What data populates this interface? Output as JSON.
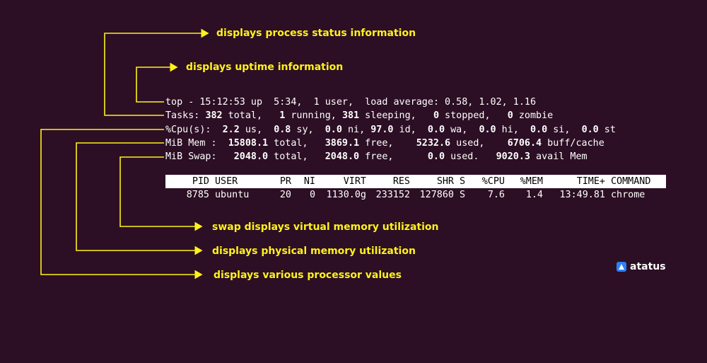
{
  "annotations": {
    "process_status": "displays process status information",
    "uptime": "displays uptime information",
    "swap": "swap displays virtual memory utilization",
    "physical_memory": "displays physical memory utilization",
    "processor": "displays various processor values"
  },
  "summary": {
    "top_line": {
      "prefix": "top - 15:12:53 up  5:34,  1 user,  load average: 0.58, 1.02, 1.16"
    },
    "tasks_line": {
      "label": "Tasks: ",
      "total": "382",
      "total_label": " total,   ",
      "running": "1",
      "running_label": " running, ",
      "sleeping": "381",
      "sleeping_label": " sleeping,   ",
      "stopped": "0",
      "stopped_label": " stopped,   ",
      "zombie": "0",
      "zombie_label": " zombie"
    },
    "cpu_line": {
      "label": "%Cpu(s):  ",
      "us": "2.2",
      "us_label": " us,  ",
      "sy": "0.8",
      "sy_label": " sy,  ",
      "ni": "0.0",
      "ni_label": " ni, ",
      "id": "97.0",
      "id_label": " id,  ",
      "wa": "0.0",
      "wa_label": " wa,  ",
      "hi": "0.0",
      "hi_label": " hi,  ",
      "si": "0.0",
      "si_label": " si,  ",
      "st": "0.0",
      "st_label": " st"
    },
    "mem_line": {
      "label": "MiB Mem :  ",
      "total": "15808.1",
      "total_label": " total,   ",
      "free": "3869.1",
      "free_label": " free,    ",
      "used": "5232.6",
      "used_label": " used,    ",
      "buff": "6706.4",
      "buff_label": " buff/cache"
    },
    "swap_line": {
      "label": "MiB Swap:   ",
      "total": "2048.0",
      "total_label": " total,   ",
      "free": "2048.0",
      "free_label": " free,      ",
      "used": "0.0",
      "used_label": " used.   ",
      "avail": "9020.3",
      "avail_label": " avail Mem"
    }
  },
  "process_table": {
    "columns": [
      "PID",
      "USER",
      "PR",
      "NI",
      "VIRT",
      "RES",
      "SHR",
      "S",
      "%CPU",
      "%MEM",
      "TIME+",
      "COMMAND"
    ],
    "rows": [
      [
        "8785",
        "ubuntu",
        "20",
        "0",
        "1130.0g",
        "233152",
        "127860",
        "S",
        "7.6",
        "1.4",
        "13:49.81",
        "chrome"
      ]
    ]
  },
  "logo": {
    "text": "atatus",
    "icon": "atatus-logo-icon",
    "color": "#2b7fff"
  },
  "colors": {
    "background": "#2c0f24",
    "annotation": "#fff21a",
    "terminal_text": "#ffffff",
    "header_bg": "#ffffff"
  }
}
